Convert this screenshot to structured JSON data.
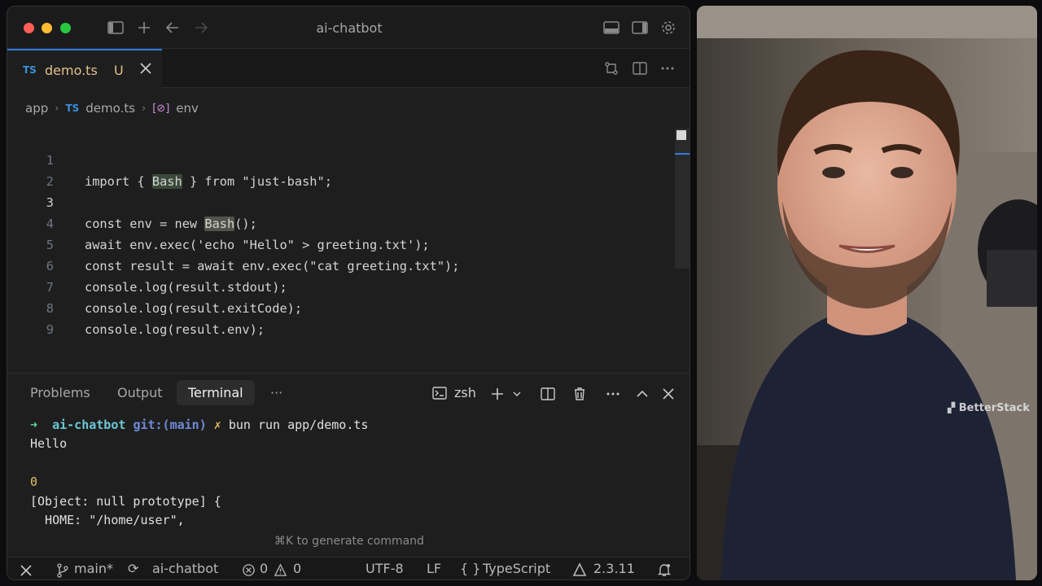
{
  "window": {
    "title": "ai-chatbot"
  },
  "tab": {
    "badge": "TS",
    "name": "demo.ts",
    "modified": "U"
  },
  "breadcrumb": {
    "folder": "app",
    "badge": "TS",
    "file": "demo.ts",
    "symbol": "env"
  },
  "code": {
    "line_numbers": [
      "1",
      "2",
      "3",
      "4",
      "5",
      "6",
      "7",
      "8",
      "9"
    ],
    "l1": {
      "a": "import { ",
      "b": "Bash",
      "c": " } from \"just-bash\";"
    },
    "l3": {
      "a": "const env = new ",
      "b": "Bash",
      "c": "();"
    },
    "l4": "await env.exec('echo \"Hello\" > greeting.txt');",
    "l5": "const result = await env.exec(\"cat greeting.txt\");",
    "l6": "console.log(result.stdout);",
    "l7": "console.log(result.exitCode);",
    "l8": "console.log(result.env);"
  },
  "panel": {
    "tabs": {
      "problems": "Problems",
      "output": "Output",
      "terminal": "Terminal",
      "more": "···"
    },
    "shell": "zsh",
    "hint": "⌘K to generate command"
  },
  "terminal": {
    "prompt_arrow": "➜",
    "prompt_dir": "ai-chatbot",
    "prompt_git": "git:(main)",
    "prompt_x": "✗",
    "command": "bun run app/demo.ts",
    "out1": "Hello",
    "out2": "0",
    "out3": "[Object: null prototype] {",
    "out4": "  HOME: \"/home/user\","
  },
  "status": {
    "branch": "main*",
    "project": "ai-chatbot",
    "errors": "0",
    "warnings": "0",
    "encoding": "UTF-8",
    "eol": "LF",
    "language": "TypeScript",
    "version": "2.3.11"
  },
  "watermark": "BetterStack",
  "colors": {
    "accent": "#2d7de0",
    "modified": "#e2c08d",
    "ts_badge": "#3b8fd9",
    "light_red": "#fe5f57",
    "light_yellow": "#febc2e",
    "light_green": "#28c840"
  }
}
